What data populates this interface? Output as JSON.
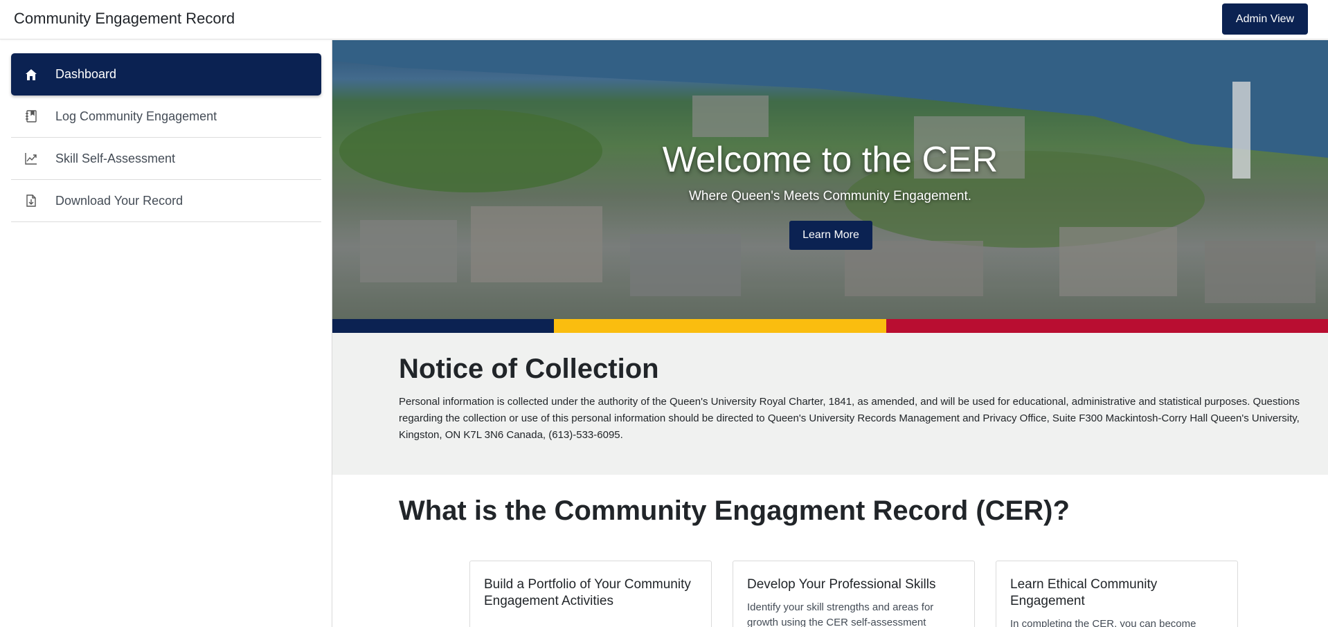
{
  "header": {
    "app_title": "Community Engagement Record",
    "admin_button": "Admin View"
  },
  "sidebar": {
    "items": [
      {
        "label": "Dashboard",
        "icon": "home-icon",
        "active": true
      },
      {
        "label": "Log Community Engagement",
        "icon": "notebook-icon",
        "active": false
      },
      {
        "label": "Skill Self-Assessment",
        "icon": "trending-chart-icon",
        "active": false
      },
      {
        "label": "Download Your Record",
        "icon": "download-file-icon",
        "active": false
      }
    ]
  },
  "hero": {
    "title": "Welcome to the CER",
    "subtitle": "Where Queen's Meets Community Engagement.",
    "button": "Learn More"
  },
  "colors": {
    "navy": "#0b2252",
    "gold": "#fabd0f",
    "red": "#b90e31",
    "notice_bg": "#f0f1f0"
  },
  "notice": {
    "title": "Notice of Collection",
    "body": "Personal information is collected under the authority of the Queen's University Royal Charter, 1841, as amended, and will be used for educational, administrative and statistical purposes. Questions regarding the collection or use of this personal information should be directed to Queen's University Records Management and Privacy Office, Suite F300 Mackintosh-Corry Hall Queen's University, Kingston, ON K7L 3N6 Canada, (613)-533-6095."
  },
  "about": {
    "title": "What is the Community Engagment Record (CER)?",
    "cards": [
      {
        "title": "Build a Portfolio of Your Community Engagement Activities",
        "text": ""
      },
      {
        "title": "Develop Your Professional Skills",
        "text": "Identify your skill strengths and areas for growth using the CER self-assessment"
      },
      {
        "title": "Learn Ethical Community Engagement",
        "text": "In completing the CER, you can become"
      }
    ]
  }
}
